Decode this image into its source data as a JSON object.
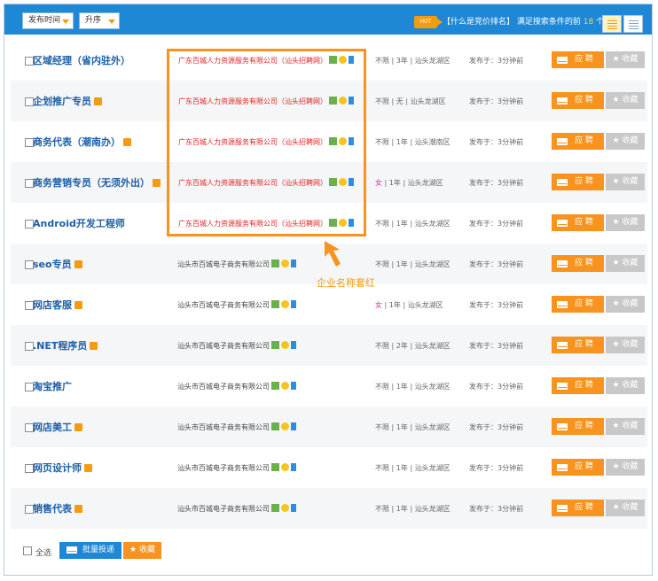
{
  "toolbar": {
    "sort_time": "发布时间",
    "order": "升序",
    "hot_badge": "HOT",
    "rank_text": "【什么是竞价排名】",
    "count_pre": "满足搜索条件的前",
    "count_num": "18",
    "count_post": "个记录"
  },
  "jobs": [
    {
      "title": "区域经理（省内驻外）",
      "tag": false,
      "company": "广东百城人力资源服务有限公司（汕头招聘网）",
      "red": true,
      "gender": "不限",
      "exp": "3年",
      "area": "汕头龙湖区",
      "time": "发布于：3分钟前"
    },
    {
      "title": "企划推广专员",
      "tag": true,
      "company": "广东百城人力资源服务有限公司（汕头招聘网）",
      "red": true,
      "gender": "不限",
      "exp": "无",
      "area": "汕头龙湖区",
      "time": "发布于：3分钟前"
    },
    {
      "title": "商务代表（潮南办）",
      "tag": true,
      "company": "广东百城人力资源服务有限公司（汕头招聘网）",
      "red": true,
      "gender": "不限",
      "exp": "1年",
      "area": "汕头潮南区",
      "time": "发布于：3分钟前"
    },
    {
      "title": "商务营销专员（无须外出）",
      "tag": true,
      "company": "广东百城人力资源服务有限公司（汕头招聘网）",
      "red": true,
      "gender": "女",
      "exp": "1年",
      "area": "汕头龙湖区",
      "time": "发布于：3分钟前"
    },
    {
      "title": "Android开发工程师",
      "tag": false,
      "company": "广东百城人力资源服务有限公司（汕头招聘网）",
      "red": true,
      "gender": "不限",
      "exp": "1年",
      "area": "汕头龙湖区",
      "time": "发布于：3分钟前"
    },
    {
      "title": "seo专员",
      "tag": true,
      "company": "汕头市百城电子商务有限公司",
      "red": false,
      "gender": "不限",
      "exp": "1年",
      "area": "汕头龙湖区",
      "time": "发布于：3分钟前"
    },
    {
      "title": "网店客服",
      "tag": true,
      "company": "汕头市百城电子商务有限公司",
      "red": false,
      "gender": "女",
      "exp": "1年",
      "area": "汕头龙湖区",
      "time": "发布于：3分钟前"
    },
    {
      "title": ".NET程序员",
      "tag": true,
      "company": "汕头市百城电子商务有限公司",
      "red": false,
      "gender": "不限",
      "exp": "2年",
      "area": "汕头龙湖区",
      "time": "发布于：3分钟前"
    },
    {
      "title": "淘宝推广",
      "tag": false,
      "company": "汕头市百城电子商务有限公司",
      "red": false,
      "gender": "不限",
      "exp": "1年",
      "area": "汕头龙湖区",
      "time": "发布于：3分钟前"
    },
    {
      "title": "网店美工",
      "tag": true,
      "company": "汕头市百城电子商务有限公司",
      "red": false,
      "gender": "不限",
      "exp": "1年",
      "area": "汕头龙湖区",
      "time": "发布于：3分钟前"
    },
    {
      "title": "网页设计师",
      "tag": true,
      "company": "汕头市百城电子商务有限公司",
      "red": false,
      "gender": "不限",
      "exp": "1年",
      "area": "汕头龙湖区",
      "time": "发布于：3分钟前"
    },
    {
      "title": "销售代表",
      "tag": true,
      "company": "汕头市百城电子商务有限公司",
      "red": false,
      "gender": "不限",
      "exp": "1年",
      "area": "汕头龙湖区",
      "time": "发布于：3分钟前"
    }
  ],
  "labels": {
    "apply": "应 聘",
    "favorite": "★ 收藏",
    "separator": "|"
  },
  "annotation": "企业名称套红",
  "footer": {
    "select_all": "全选",
    "batch_apply": "批量投递",
    "batch_favorite": "★ 收藏"
  },
  "colors": {
    "header_blue": "#1e87d6",
    "accent_orange": "#f7931e",
    "title_blue": "#1d5fa6",
    "company_red": "#e52222"
  },
  "icons": [
    "verified-icon",
    "coin-icon",
    "mobile-icon",
    "envelope-icon",
    "star-icon",
    "list-view-icon",
    "compact-view-icon"
  ]
}
